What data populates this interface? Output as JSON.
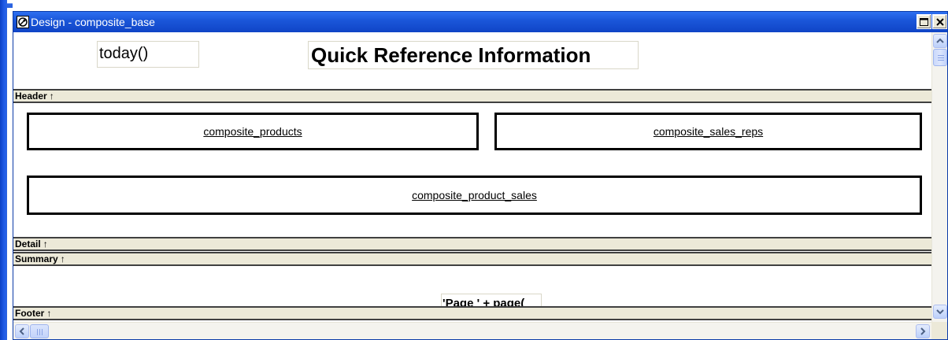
{
  "window": {
    "title": "Design - composite_base",
    "icon": "datawindow-painter-icon",
    "buttons": [
      "restore-icon",
      "close-icon"
    ]
  },
  "fields": {
    "today": "today()",
    "report_title": "Quick Reference Information",
    "page_expression": "'Page ' + page("
  },
  "bands": {
    "header": "Header",
    "detail": "Detail",
    "summary": "Summary",
    "footer": "Footer",
    "marker": "↑"
  },
  "reports": {
    "products": "composite_products",
    "sales_reps": "composite_sales_reps",
    "product_sales": "composite_product_sales"
  },
  "scrollbars": {
    "vertical_icons": [
      "chevron-up-icon",
      "chevron-down-icon"
    ],
    "horizontal_icons": [
      "chevron-left-icon",
      "chevron-right-icon"
    ]
  },
  "colors": {
    "titlebar": "#0f44c6",
    "band": "#ece9d8",
    "scroll": "#bcd0fa"
  }
}
